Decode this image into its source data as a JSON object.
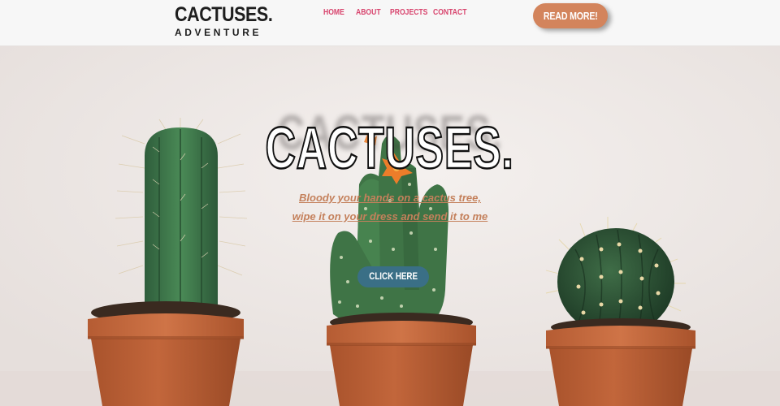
{
  "header": {
    "logo": {
      "main": "CACTUSES.",
      "sub": "ADVENTURE"
    },
    "nav": [
      {
        "label": "HOME"
      },
      {
        "label": "ABOUT"
      },
      {
        "label": "PROJECTS"
      },
      {
        "label": "CONTACT"
      }
    ],
    "cta_label": "READ MORE!"
  },
  "hero": {
    "title": "CACTUSES.",
    "quote_line1": "Bloody your hands on a cactus tree,",
    "quote_line2": "wipe it on your dress and send it to me",
    "button_label": "CLICK HERE"
  },
  "colors": {
    "nav_link": "#d8456e",
    "cta": "#d3845c",
    "hero_button": "#3a6f86",
    "quote": "#c4805b"
  }
}
